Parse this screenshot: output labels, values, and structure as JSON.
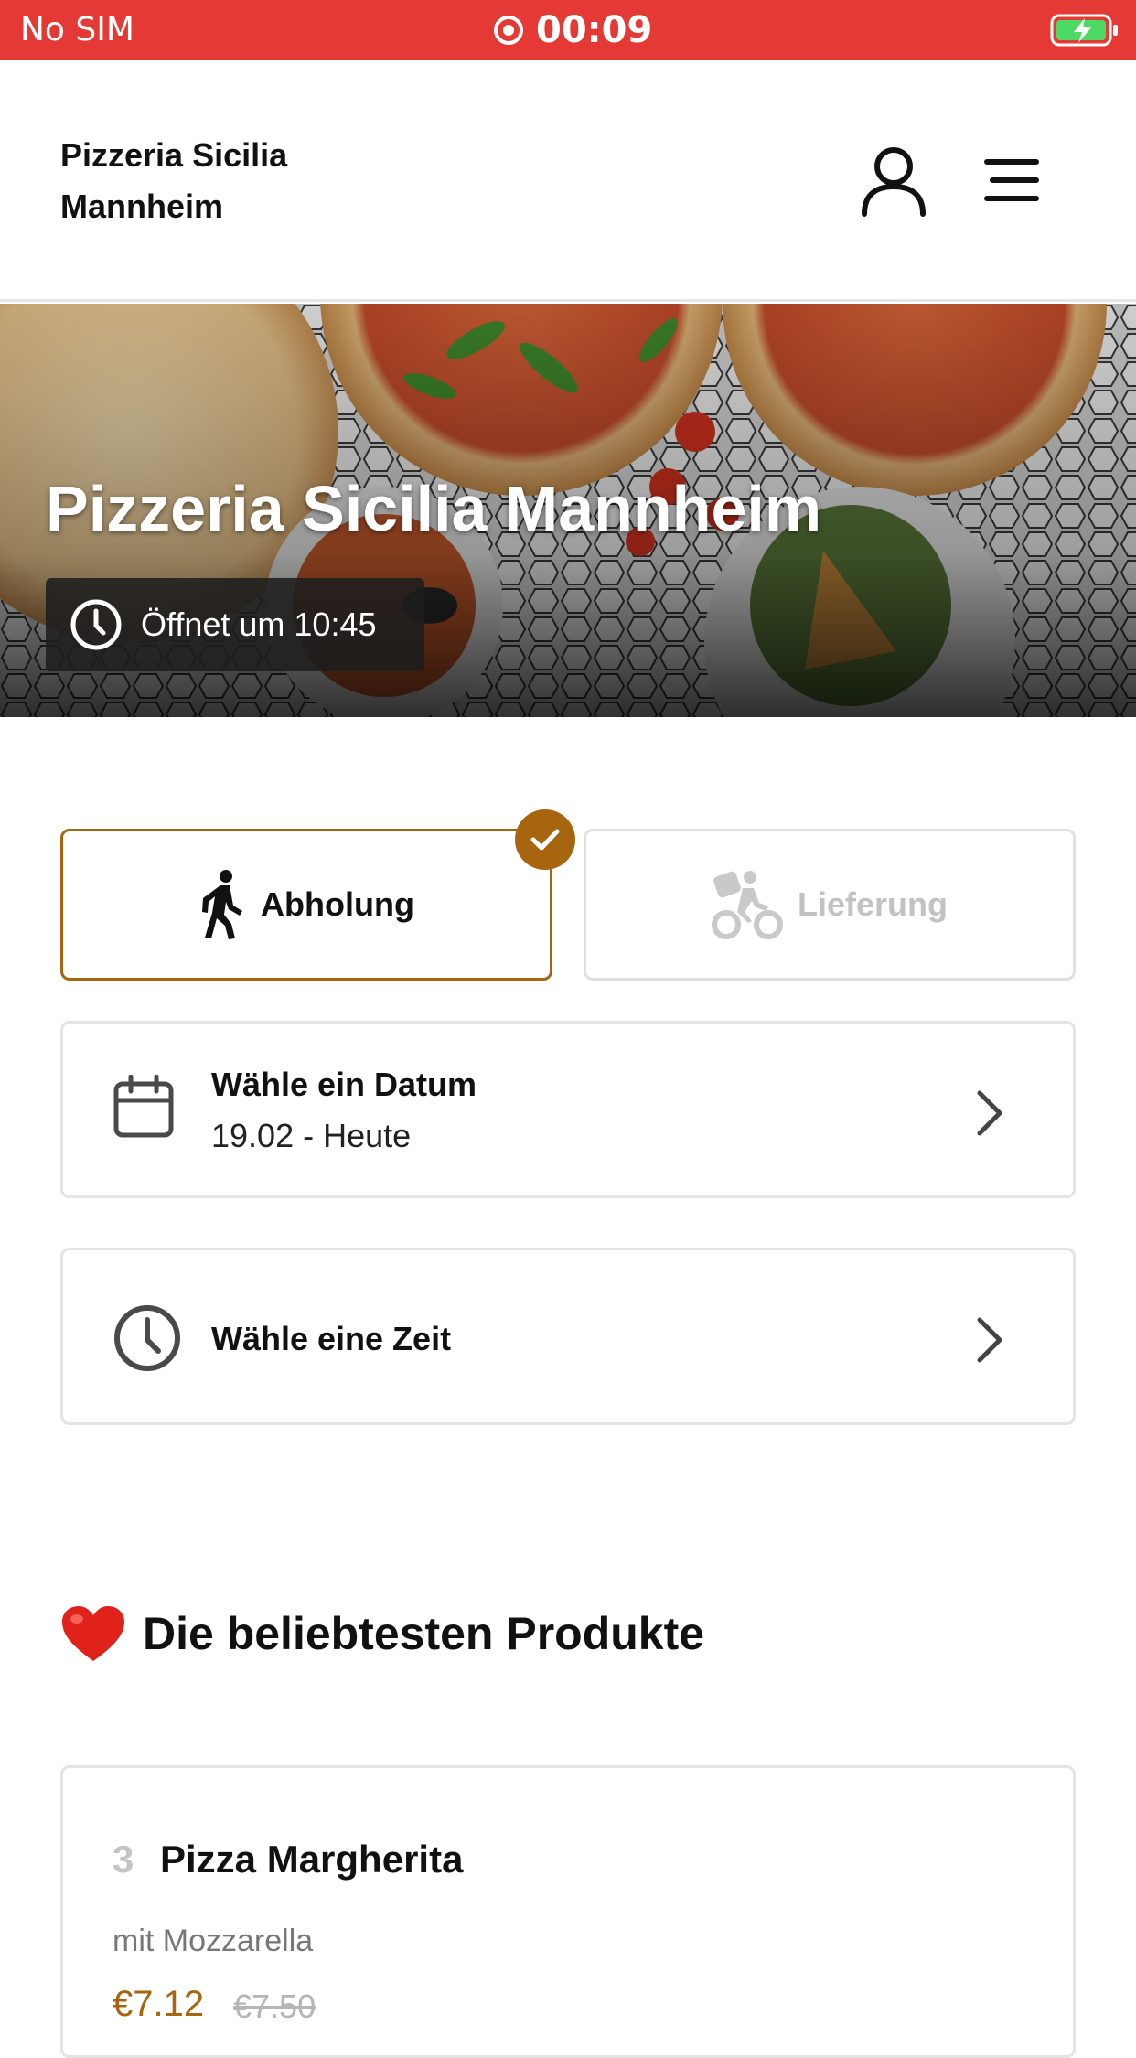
{
  "status_bar": {
    "carrier": "No SIM",
    "time": "00:09",
    "background_color": "#e53935",
    "battery_icon": "battery-charging-icon",
    "recording_icon": "screen-recording-icon"
  },
  "header": {
    "brand_line1": "Pizzeria Sicilia",
    "brand_line2": "Mannheim",
    "user_icon": "user-icon",
    "menu_icon": "hamburger-menu-icon"
  },
  "hero": {
    "title": "Pizzeria Sicilia Mannheim",
    "hours_text": "Öffnet um 10:45",
    "hours_icon": "clock-icon"
  },
  "order_mode": {
    "pickup_label": "Abholung",
    "pickup_icon": "walking-person-icon",
    "pickup_selected": true,
    "delivery_label": "Lieferung",
    "delivery_icon": "bicycle-courier-icon",
    "delivery_selected": false,
    "accent_color": "#a8650f"
  },
  "date_select": {
    "label": "Wähle ein Datum",
    "value": "19.02 - Heute",
    "icon": "calendar-icon"
  },
  "time_select": {
    "label": "Wähle eine Zeit",
    "icon": "clock-icon"
  },
  "popular": {
    "title": "Die beliebtesten Produkte",
    "emoji": "heart-icon",
    "products": [
      {
        "rank": "3",
        "name": "Pizza Margherita",
        "description": "mit Mozzarella",
        "price": "€7.12",
        "old_price": "€7.50"
      }
    ]
  }
}
